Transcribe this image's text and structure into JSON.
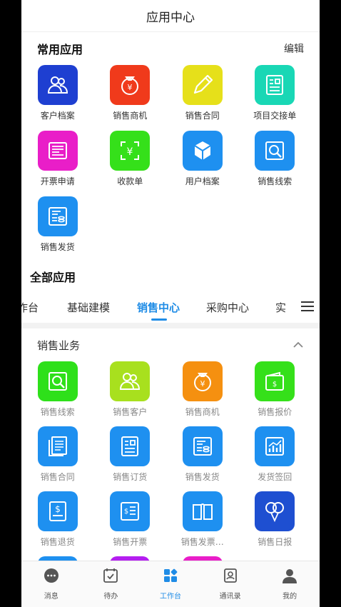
{
  "header": {
    "title": "应用中心"
  },
  "favorites": {
    "title": "常用应用",
    "edit_label": "编辑",
    "items": [
      {
        "label": "客户档案",
        "icon": "users-icon",
        "color": "#1e3fd1"
      },
      {
        "label": "销售商机",
        "icon": "money-bag-icon",
        "color": "#f03a1b"
      },
      {
        "label": "销售合同",
        "icon": "pencil-icon",
        "color": "#e6e01a"
      },
      {
        "label": "项目交接单",
        "icon": "document-icon",
        "color": "#19d7b5"
      },
      {
        "label": "开票申请",
        "icon": "invoice-icon",
        "color": "#e91ec8"
      },
      {
        "label": "收款单",
        "icon": "yuan-scan-icon",
        "color": "#35e01a"
      },
      {
        "label": "用户档案",
        "icon": "cube-icon",
        "color": "#1e90f0"
      },
      {
        "label": "销售线索",
        "icon": "search-doc-icon",
        "color": "#1e90f0"
      },
      {
        "label": "销售发货",
        "icon": "delivery-doc-icon",
        "color": "#1e90f0"
      }
    ]
  },
  "all_apps": {
    "title": "全部应用",
    "tabs": [
      "作台",
      "基础建模",
      "销售中心",
      "采购中心",
      "实"
    ],
    "active_tab": "销售中心"
  },
  "sales": {
    "title": "销售业务",
    "items": [
      {
        "label": "销售线索",
        "icon": "search-doc-icon",
        "color": "#2ee01a"
      },
      {
        "label": "销售客户",
        "icon": "users-icon",
        "color": "#a8e01e"
      },
      {
        "label": "销售商机",
        "icon": "money-bag-icon",
        "color": "#f59010"
      },
      {
        "label": "销售报价",
        "icon": "wallet-icon",
        "color": "#35e01a"
      },
      {
        "label": "销售合同",
        "icon": "contract-icon",
        "color": "#1e90f0"
      },
      {
        "label": "销售订货",
        "icon": "document-icon",
        "color": "#1e90f0"
      },
      {
        "label": "销售发货",
        "icon": "delivery-doc-icon",
        "color": "#1e90f0"
      },
      {
        "label": "发货签回",
        "icon": "chart-icon",
        "color": "#1e90f0"
      },
      {
        "label": "销售退货",
        "icon": "return-doc-icon",
        "color": "#1e90f0"
      },
      {
        "label": "销售开票",
        "icon": "invoice-list-icon",
        "color": "#1e90f0"
      },
      {
        "label": "销售发票…",
        "icon": "book-icon",
        "color": "#1e90f0"
      },
      {
        "label": "销售日报",
        "icon": "balloons-icon",
        "color": "#1e4fd1"
      },
      {
        "label": "",
        "icon": "document-icon",
        "color": "#1e90f0"
      },
      {
        "label": "",
        "icon": "invoice-icon",
        "color": "#b41ef0"
      },
      {
        "label": "",
        "icon": "file-icon",
        "color": "#e91ec8"
      }
    ]
  },
  "bottom_nav": [
    {
      "label": "消息",
      "icon": "chat-icon"
    },
    {
      "label": "待办",
      "icon": "checklist-icon"
    },
    {
      "label": "工作台",
      "icon": "workbench-icon"
    },
    {
      "label": "通讯录",
      "icon": "contacts-icon"
    },
    {
      "label": "我的",
      "icon": "profile-icon"
    }
  ],
  "colors": {
    "accent": "#1f8ce6"
  }
}
